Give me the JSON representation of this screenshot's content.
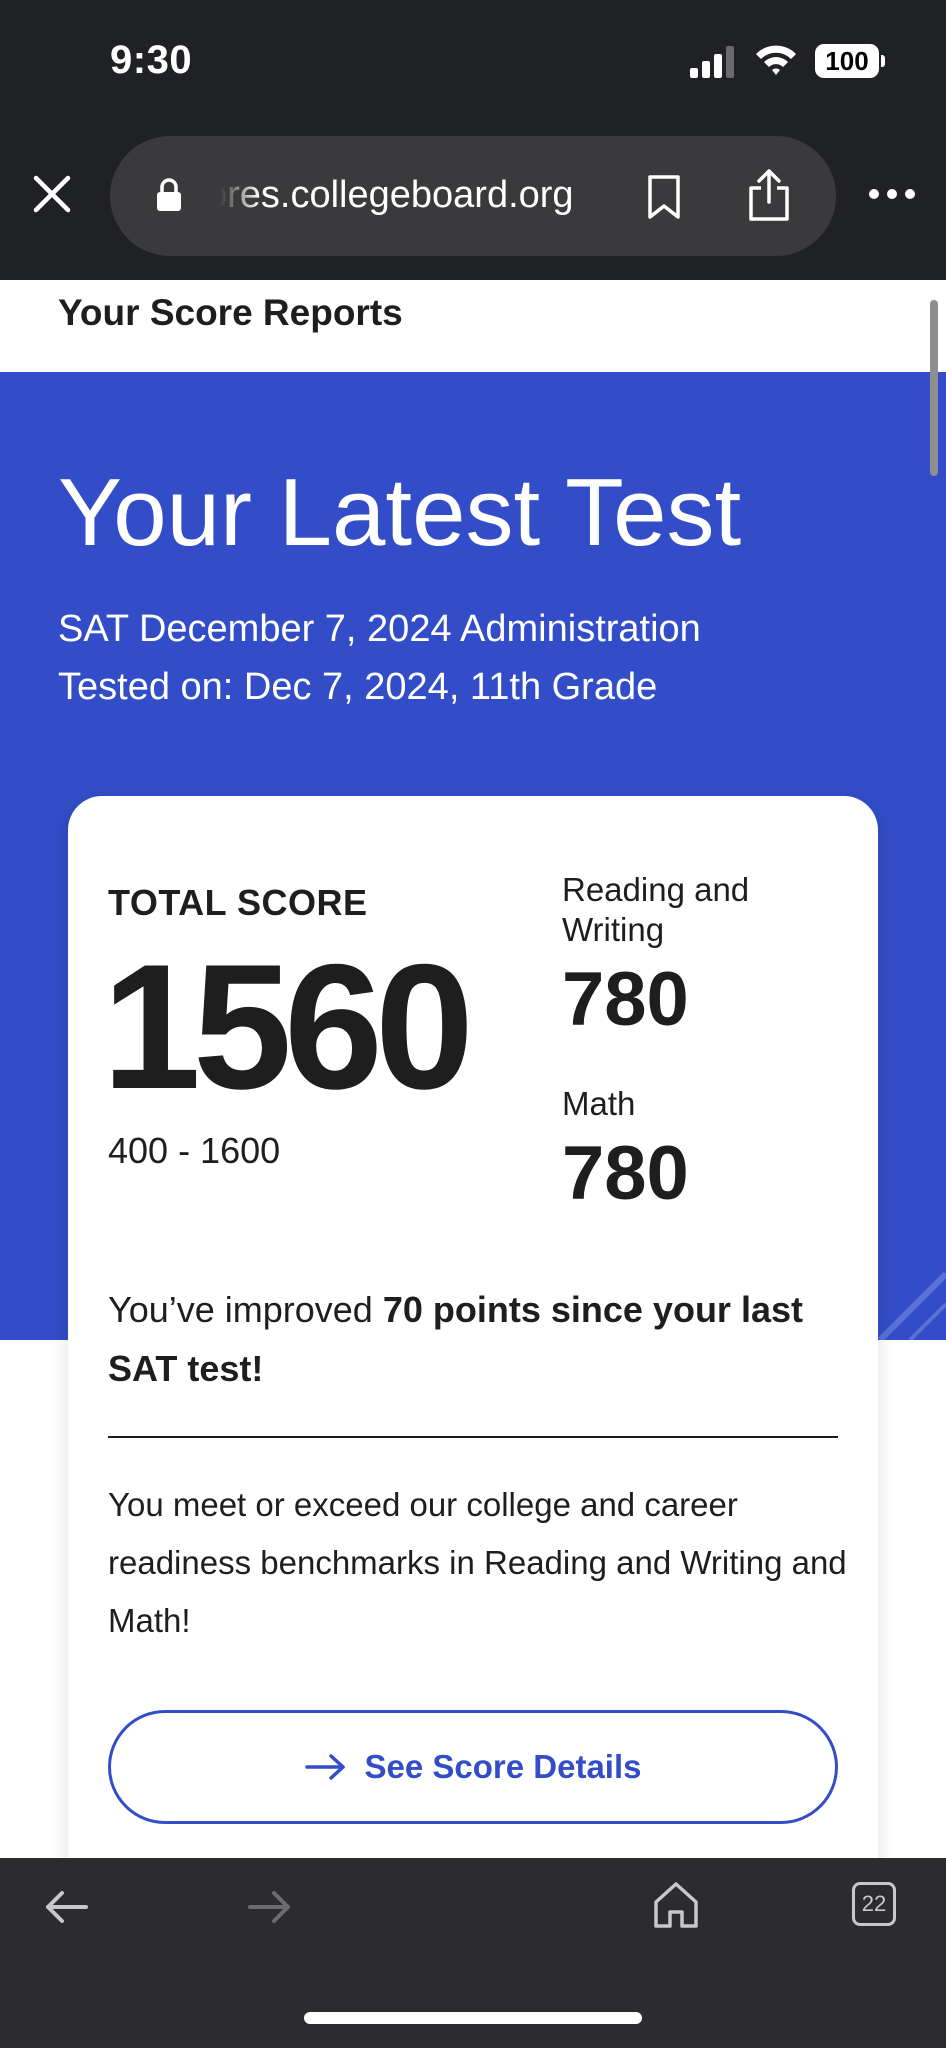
{
  "status_bar": {
    "time": "9:30",
    "battery": "100",
    "icons": [
      "signal-icon",
      "wifi-icon",
      "battery-icon"
    ]
  },
  "browser": {
    "url": "ores.collegeboard.org",
    "icons": [
      "close-icon",
      "lock-icon",
      "bookmark-icon",
      "share-icon",
      "more-icon"
    ]
  },
  "page_header": {
    "title": "Your Score Reports"
  },
  "hero": {
    "title": "Your Latest Test",
    "administration": "SAT December 7, 2024 Administration",
    "tested_on": "Tested on: Dec 7, 2024, 11th Grade"
  },
  "score_card": {
    "total_label": "TOTAL SCORE",
    "total_score": "1560",
    "range": "400 - 1600",
    "sections": [
      {
        "label": "Reading and Writing",
        "score": "780"
      },
      {
        "label": "Math",
        "score": "780"
      }
    ],
    "improved_prefix": "You’ve improved ",
    "improved_bold": "70 points since your last SAT test!",
    "benchmark": "You meet or exceed our college and career readiness benchmarks in Reading and Writing and Math!",
    "details_button": "See Score Details"
  },
  "toolbar": {
    "tab_count": "22",
    "icons": [
      "back-icon",
      "forward-icon",
      "home-icon",
      "tabs-icon"
    ]
  },
  "colors": {
    "brand_blue": "#324dc7",
    "chrome_dark": "#202124",
    "toolbar_dark": "#2c2c2e",
    "text_dark": "#1e1e1e"
  }
}
